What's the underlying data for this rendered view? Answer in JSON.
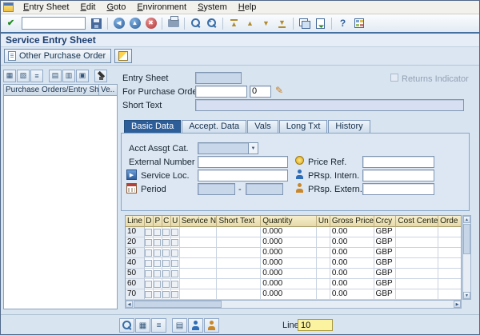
{
  "colors": {
    "accent_blue": "#2d5e9a",
    "table_header_tan": "#ece1ae",
    "highlight_yellow": "#fbf3a0",
    "title_blue": "#1d3f72"
  },
  "menubar": {
    "items": [
      "Entry Sheet",
      "Edit",
      "Goto",
      "Environment",
      "System",
      "Help"
    ]
  },
  "icons": {
    "enter": "✔",
    "back": "◀",
    "exit": "▲",
    "cancel": "✖",
    "page_first": "▲",
    "page_prev": "▲",
    "page_next": "▼",
    "page_last": "▼",
    "help": "?",
    "dropdown": "▼",
    "display_change": "✎",
    "service_loc_arrow": "▶",
    "grid": "▦",
    "grid2": "▧",
    "list": "≡",
    "grid3": "▤",
    "grid4": "▥",
    "grid5": "▣",
    "scroll_up": "▲",
    "scroll_down": "▼",
    "scroll_left": "◀",
    "scroll_right": "▶"
  },
  "header": {
    "title": "Service Entry Sheet"
  },
  "app_toolbar": {
    "other_purchase_order": "Other Purchase Order"
  },
  "left_panel": {
    "header_main": "Purchase Orders/Entry Sheets",
    "header_vendor": "Ve.."
  },
  "form": {
    "entry_sheet_label": "Entry Sheet",
    "entry_sheet_value": "",
    "for_purchase_order_label": "For Purchase Order",
    "purchase_order_value": "",
    "purchase_order_item": "0",
    "short_text_label": "Short Text",
    "short_text_value": "",
    "returns_indicator_label": "Returns Indicator"
  },
  "tabs": [
    {
      "label": "Basic Data",
      "selected": true
    },
    {
      "label": "Accept. Data",
      "selected": false
    },
    {
      "label": "Vals",
      "selected": false
    },
    {
      "label": "Long Txt",
      "selected": false
    },
    {
      "label": "History",
      "selected": false
    }
  ],
  "basic_data": {
    "acct_assgt_cat_label": "Acct Assgt Cat.",
    "acct_assgt_cat_value": "",
    "external_number_label": "External Number",
    "external_number_value": "",
    "service_loc_label": "Service Loc.",
    "service_loc_value": "",
    "period_label": "Period",
    "period_from": "",
    "period_separator": "-",
    "period_to": "",
    "price_ref_label": "Price Ref.",
    "price_ref_value": "",
    "prsp_intern_label": "PRsp. Intern.",
    "prsp_intern_value": "",
    "prsp_extern_label": "PRsp. Extern.",
    "prsp_extern_value": ""
  },
  "table": {
    "columns": [
      "Line",
      "D",
      "P",
      "C",
      "U",
      "Service No.",
      "Short Text",
      "Quantity",
      "Un",
      "Gross Price",
      "Crcy",
      "Cost Center",
      "Orde"
    ],
    "rows": [
      {
        "line": "10",
        "d": false,
        "p": false,
        "c": false,
        "u": false,
        "service_no": "",
        "short_text": "",
        "quantity": "0.000",
        "un": "",
        "gross_price": "0.00",
        "crcy": "GBP",
        "cost_center": "",
        "orde": ""
      },
      {
        "line": "20",
        "d": false,
        "p": false,
        "c": false,
        "u": false,
        "service_no": "",
        "short_text": "",
        "quantity": "0.000",
        "un": "",
        "gross_price": "0.00",
        "crcy": "GBP",
        "cost_center": "",
        "orde": ""
      },
      {
        "line": "30",
        "d": false,
        "p": false,
        "c": false,
        "u": false,
        "service_no": "",
        "short_text": "",
        "quantity": "0.000",
        "un": "",
        "gross_price": "0.00",
        "crcy": "GBP",
        "cost_center": "",
        "orde": ""
      },
      {
        "line": "40",
        "d": false,
        "p": false,
        "c": false,
        "u": false,
        "service_no": "",
        "short_text": "",
        "quantity": "0.000",
        "un": "",
        "gross_price": "0.00",
        "crcy": "GBP",
        "cost_center": "",
        "orde": ""
      },
      {
        "line": "50",
        "d": false,
        "p": false,
        "c": false,
        "u": false,
        "service_no": "",
        "short_text": "",
        "quantity": "0.000",
        "un": "",
        "gross_price": "0.00",
        "crcy": "GBP",
        "cost_center": "",
        "orde": ""
      },
      {
        "line": "60",
        "d": false,
        "p": false,
        "c": false,
        "u": false,
        "service_no": "",
        "short_text": "",
        "quantity": "0.000",
        "un": "",
        "gross_price": "0.00",
        "crcy": "GBP",
        "cost_center": "",
        "orde": ""
      },
      {
        "line": "70",
        "d": false,
        "p": false,
        "c": false,
        "u": false,
        "service_no": "",
        "short_text": "",
        "quantity": "0.000",
        "un": "",
        "gross_price": "0.00",
        "crcy": "GBP",
        "cost_center": "",
        "orde": ""
      }
    ]
  },
  "footer": {
    "line_label": "Line",
    "line_value": "10"
  }
}
